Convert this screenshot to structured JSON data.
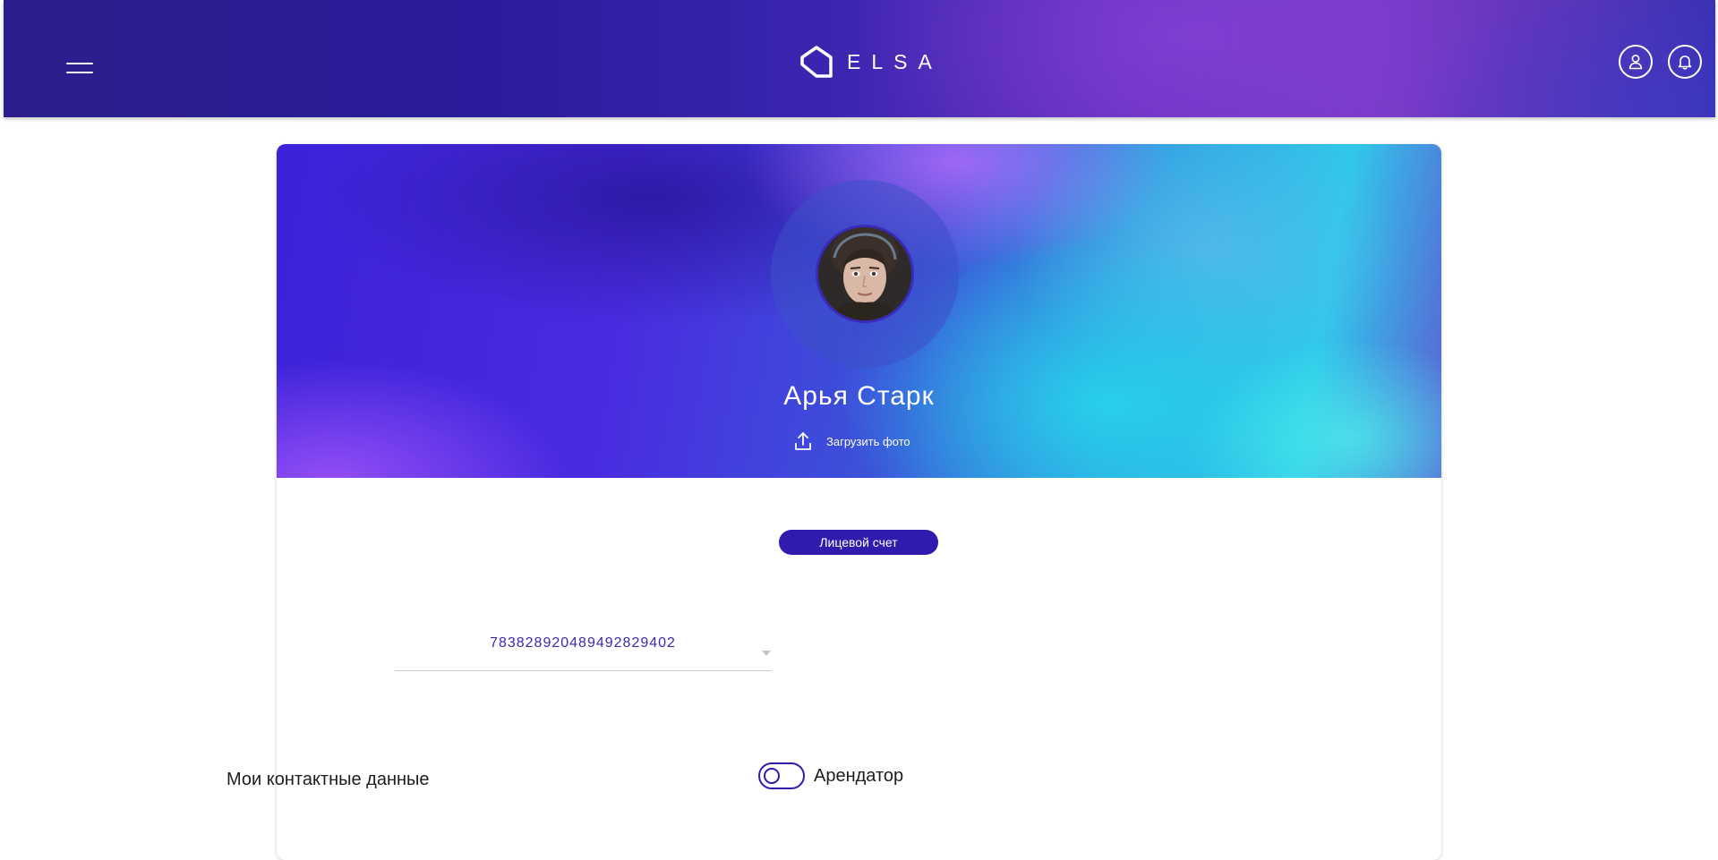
{
  "header": {
    "brand": "ELSA",
    "menu_icon": "hamburger-menu-icon",
    "logo_icon": "house-outline-icon",
    "actions": [
      {
        "icon": "user-icon"
      },
      {
        "icon": "bell-icon"
      }
    ]
  },
  "profile": {
    "name": "Арья Старк",
    "upload_label": "Загрузить фото",
    "upload_icon": "upload-icon",
    "avatar_icon": "user-photo-avatar"
  },
  "account": {
    "chip_label": "Лицевой счет",
    "selected_number": "78382892048949282940​2",
    "caret_icon": "chevron-down-icon"
  },
  "contacts": {
    "title": "Мои контактные данные",
    "tenant_label": "Арендатор",
    "tenant_toggle_on": false
  },
  "colors": {
    "accent": "#2f1cae",
    "header_start": "#2b1e8c",
    "header_end": "#7a3ac8",
    "banner_cyan": "#30c8ea"
  }
}
